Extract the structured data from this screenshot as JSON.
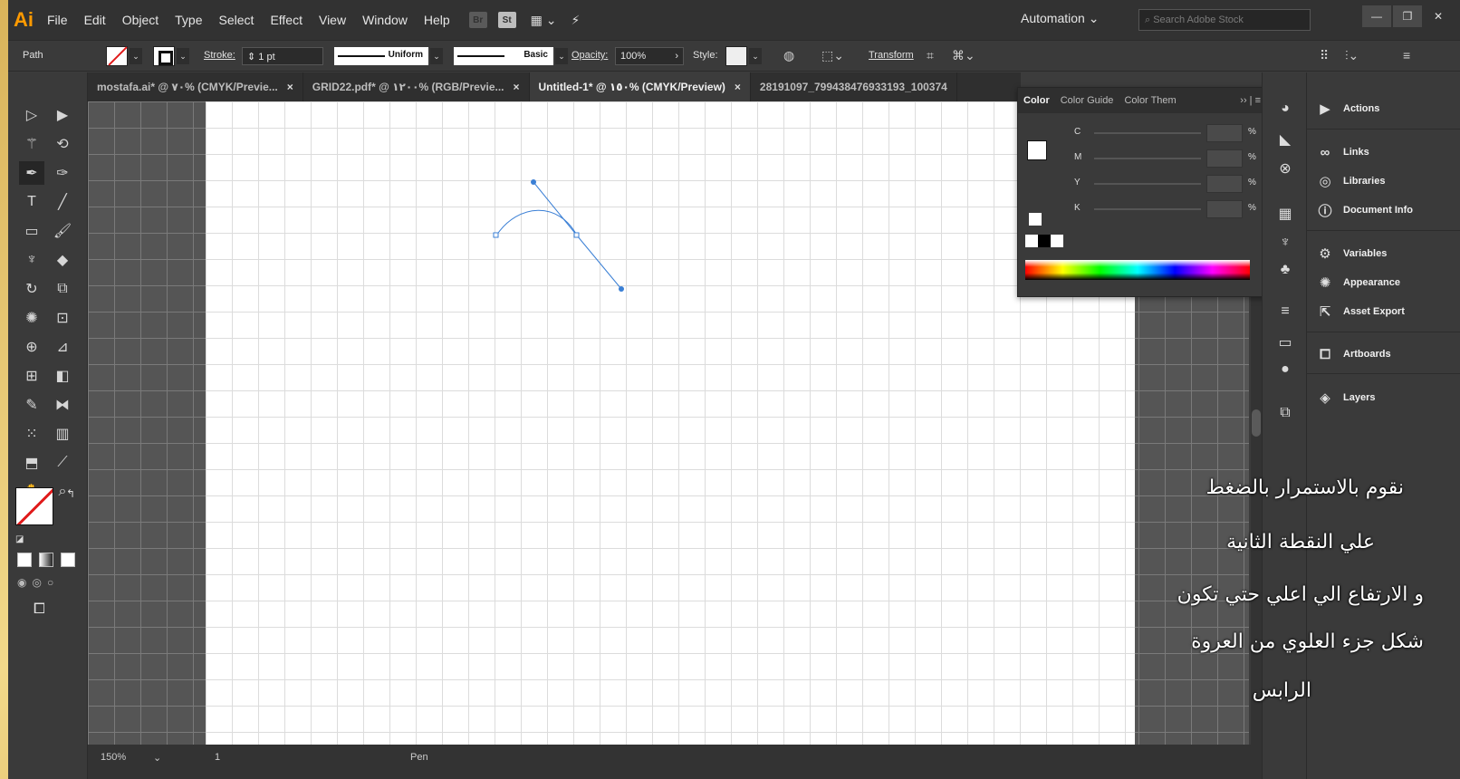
{
  "app": {
    "logo": "Ai"
  },
  "menu": [
    "File",
    "Edit",
    "Object",
    "Type",
    "Select",
    "Effect",
    "View",
    "Window",
    "Help"
  ],
  "menu_badges": [
    "Br",
    "St"
  ],
  "workspace": "Automation",
  "stock_search": {
    "placeholder": "Search Adobe Stock"
  },
  "control_bar": {
    "selection": "Path",
    "stroke_label": "Stroke:",
    "stroke_value": "1 pt",
    "profile": "Uniform",
    "brush": "Basic",
    "opacity_label": "Opacity:",
    "opacity_value": "100%",
    "style_label": "Style:",
    "transform_label": "Transform"
  },
  "tabs": [
    {
      "label": "mostafa.ai* @ ٧٠% (CMYK/Previe...",
      "close": "×"
    },
    {
      "label": "GRID22.pdf* @ ١٢٠٠% (RGB/Previe...",
      "close": "×"
    },
    {
      "label": "Untitled-1* @ ١٥٠% (CMYK/Preview)",
      "close": "×",
      "active": true
    },
    {
      "label": "28191097_799438476933193_100374",
      "close": ""
    }
  ],
  "status": {
    "zoom": "150%",
    "artboard": "1",
    "tool": "Pen"
  },
  "color_panel": {
    "tabs": [
      "Color",
      "Color Guide",
      "Color Them"
    ],
    "channels": [
      "C",
      "M",
      "Y",
      "K"
    ],
    "unit": "%"
  },
  "right_panel": {
    "items": [
      "Actions",
      "Links",
      "Libraries",
      "Document Info",
      "Variables",
      "Appearance",
      "Asset Export",
      "Artboards",
      "Layers"
    ]
  },
  "overlay_text": [
    "نقوم بالاستمرار بالضغط",
    "علي النقطة الثانية",
    "و الارتفاع الي اعلي حتي تكون",
    "شكل جزء العلوي من العروة",
    "الرابس"
  ],
  "colors": {
    "accent": "#ff9a00",
    "path": "#3a7fd5",
    "none_slash": "#e01a1a"
  }
}
